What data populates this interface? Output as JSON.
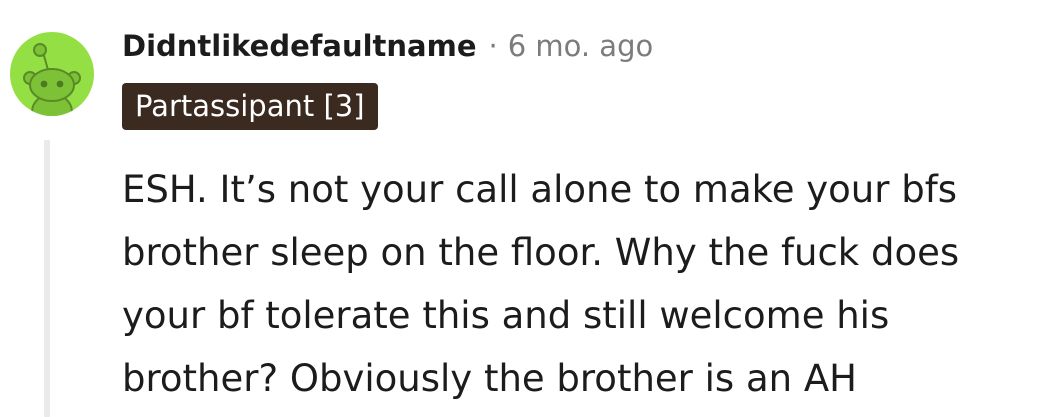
{
  "comment": {
    "author": "Didntlikedefaultname",
    "separator": "·",
    "timestamp": "6 mo. ago",
    "flair": "Partassipant [3]",
    "body": "ESH. It’s not your call alone to make your bfs brother sleep on the floor. Why the fuck does your bf tolerate this and still welcome his brother? Obviously the brother is an AH"
  },
  "avatar": {
    "icon": "snoo-avatar-icon",
    "background_color": "#94e044"
  },
  "colors": {
    "flair_background": "#3a2a20",
    "meta_text": "#7c7c7c",
    "text": "#1c1c1c",
    "thread_line": "#e8eaeb"
  }
}
